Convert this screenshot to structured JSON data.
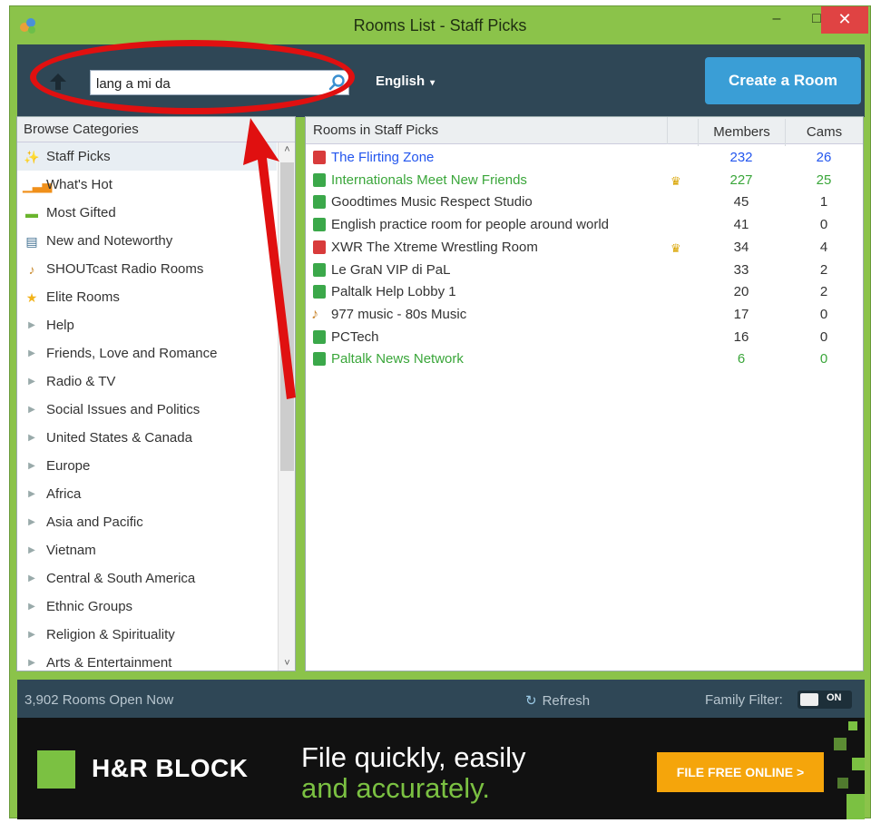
{
  "window": {
    "title": "Rooms List - Staff Picks",
    "minimize": "–",
    "maximize": "□",
    "close": "✕"
  },
  "header": {
    "search_value": "lang a mi da",
    "language": "English",
    "language_caret": "▾",
    "create_room": "Create a Room"
  },
  "categories": {
    "title": "Browse Categories",
    "items": [
      {
        "label": "Staff Picks",
        "icon": "✨"
      },
      {
        "label": "What's Hot",
        "icon": "▁▃▅"
      },
      {
        "label": "Most Gifted",
        "icon": "▬"
      },
      {
        "label": "New and Noteworthy",
        "icon": "▤"
      },
      {
        "label": "SHOUTcast Radio Rooms",
        "icon": "♪"
      },
      {
        "label": "Elite Rooms",
        "icon": "★"
      },
      {
        "label": "Help"
      },
      {
        "label": "Friends, Love and Romance"
      },
      {
        "label": "Radio & TV"
      },
      {
        "label": "Social Issues and Politics"
      },
      {
        "label": "United States & Canada"
      },
      {
        "label": "Europe"
      },
      {
        "label": "Africa"
      },
      {
        "label": "Asia and Pacific"
      },
      {
        "label": "Vietnam"
      },
      {
        "label": "Central & South America"
      },
      {
        "label": "Ethnic Groups"
      },
      {
        "label": "Religion & Spirituality"
      },
      {
        "label": "Arts & Entertainment"
      }
    ],
    "arrow": "▶",
    "scroll_up": "˄",
    "scroll_down": "˅"
  },
  "rooms": {
    "header_name": "Rooms in Staff Picks",
    "header_members": "Members",
    "header_cams": "Cams",
    "rows": [
      {
        "name": "The Flirting Zone",
        "members": "232",
        "cams": "26",
        "color": "#2255ee",
        "icon": "red-badge",
        "crown": ""
      },
      {
        "name": "Internationals Meet New Friends",
        "members": "227",
        "cams": "25",
        "color": "#3aa63a",
        "icon": "green-badge",
        "crown": "♛"
      },
      {
        "name": "Goodtimes Music Respect Studio",
        "members": "45",
        "cams": "1",
        "color": "#333333",
        "icon": "green-badge",
        "crown": ""
      },
      {
        "name": "English practice room for people around world",
        "members": "41",
        "cams": "0",
        "color": "#333333",
        "icon": "green-badge",
        "crown": ""
      },
      {
        "name": "XWR The Xtreme Wrestling Room",
        "members": "34",
        "cams": "4",
        "color": "#333333",
        "icon": "red-badge",
        "crown": "♛"
      },
      {
        "name": "Le GraN VIP di PaL",
        "members": "33",
        "cams": "2",
        "color": "#333333",
        "icon": "green-badge",
        "crown": ""
      },
      {
        "name": "Paltalk Help Lobby 1",
        "members": "20",
        "cams": "2",
        "color": "#333333",
        "icon": "green-badge",
        "crown": ""
      },
      {
        "name": "977 music - 80s Music",
        "members": "17",
        "cams": "0",
        "color": "#333333",
        "icon": "microphone",
        "crown": ""
      },
      {
        "name": "PCTech",
        "members": "16",
        "cams": "0",
        "color": "#333333",
        "icon": "green-badge",
        "crown": ""
      },
      {
        "name": "Paltalk News Network",
        "members": "6",
        "cams": "0",
        "color": "#3aa63a",
        "icon": "green-badge",
        "crown": ""
      }
    ]
  },
  "status": {
    "rooms_open": "3,902 Rooms Open Now",
    "refresh": "Refresh",
    "refresh_icon": "↻",
    "family_filter": "Family Filter:",
    "family_filter_state": "ON"
  },
  "ad": {
    "brand": "H&R BLOCK",
    "line1": "File quickly, easily",
    "line2": "and accurately.",
    "cta": "FILE FREE ONLINE >"
  },
  "colors": {
    "window_green": "#8bc34a",
    "header_navy": "#2f4756",
    "create_blue": "#3a9ed6",
    "annotation_red": "#e01010",
    "ad_green": "#7bc142",
    "ad_orange": "#f5a50b"
  }
}
